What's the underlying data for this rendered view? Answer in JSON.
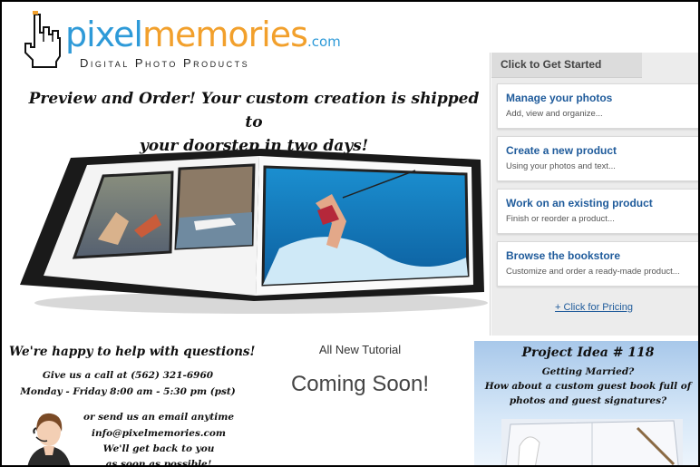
{
  "header": {
    "logo_word_1": "pixel",
    "logo_word_2": "memories",
    "logo_word_3": ".com",
    "logo_subtitle": "Digital Photo Products",
    "tagline_1": "Preview and Order!  Your custom creation is shipped to",
    "tagline_2": "your doorstep in two days!"
  },
  "panel": {
    "tab_label": "Click to Get Started",
    "items": [
      {
        "title": "Manage your photos",
        "subtitle": "Add, view and organize..."
      },
      {
        "title": "Create a new product",
        "subtitle": "Using your photos and text..."
      },
      {
        "title": "Work on an existing product",
        "subtitle": "Finish or reorder a product..."
      },
      {
        "title": "Browse the bookstore",
        "subtitle": "Customize and order a ready-made product..."
      }
    ],
    "pricing_link": "+ Click for Pricing"
  },
  "help": {
    "title": "We're happy to help with questions!",
    "line_1": "Give us a call at (562) 321-6960",
    "line_2": "Monday - Friday 8:00 am - 5:30 pm (pst)",
    "line_3": "or send us an email anytime",
    "line_4": "info@pixelmemories.com",
    "line_5": "We'll get back to you",
    "line_6": "as soon as possible!"
  },
  "tutorial": {
    "heading": "All New Tutorial",
    "status": "Coming Soon!"
  },
  "project": {
    "title": "Project Idea # 118",
    "line_1": "Getting Married?",
    "line_2": "How about a custom guest book full of",
    "line_3": "photos and guest signatures?"
  },
  "colors": {
    "logo_blue": "#2e9ad8",
    "logo_orange": "#f2a02c",
    "link_blue": "#1f5b9b",
    "panel_bg": "#ececec"
  }
}
